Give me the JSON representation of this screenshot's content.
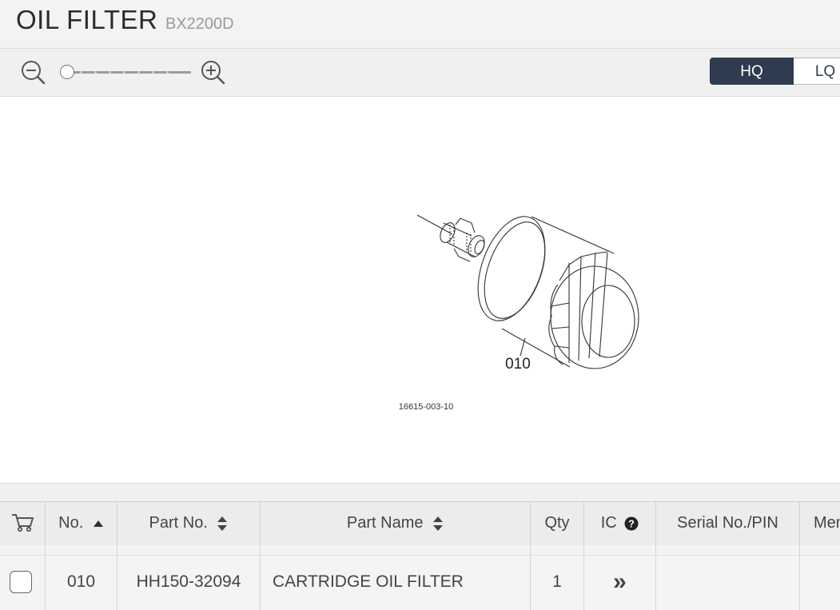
{
  "header": {
    "title": "OIL FILTER",
    "model": "BX2200D"
  },
  "toolbar": {
    "zoom_out_icon": "zoom-out-icon",
    "zoom_in_icon": "zoom-in-icon",
    "zoom_level": 0,
    "quality": {
      "hq_label": "HQ",
      "lq_label": "LQ",
      "selected": "HQ"
    }
  },
  "diagram": {
    "callout": "010",
    "drawing_id": "16615-003-10"
  },
  "table": {
    "headers": {
      "cart_icon": "cart-icon",
      "no": "No.",
      "part_no": "Part No.",
      "part_name": "Part Name",
      "qty": "Qty",
      "ic": "IC",
      "serial": "Serial No./PIN",
      "memo": "Memo"
    },
    "rows": [
      {
        "no": "010",
        "part_no": "HH150-32094",
        "part_name": "CARTRIDGE OIL FILTER",
        "qty": "1",
        "ic": "»"
      }
    ]
  },
  "colors": {
    "accent": "#2e3b50",
    "header_bg": "#f2f3f4"
  }
}
